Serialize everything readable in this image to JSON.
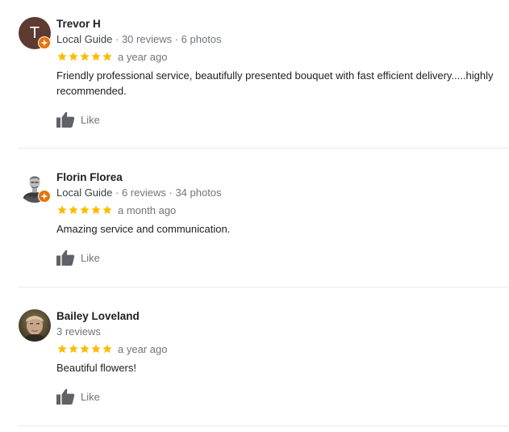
{
  "colors": {
    "star": "#fbbc04",
    "meta": "#70757a",
    "text": "#202124",
    "guide_badge": "#e8710a",
    "letter_avatar_bg": "#5d3b32"
  },
  "reviews": [
    {
      "avatar_letter": "T",
      "name": "Trevor H",
      "guide": "Local Guide",
      "sep1": " · ",
      "reviews_count": "30 reviews",
      "sep2": " · ",
      "photos_count": "6 photos",
      "rating": 5,
      "date": "a year ago",
      "text": "Friendly professional service,  beautifully presented bouquet with fast efficient delivery.....highly recommended.",
      "like_label": "Like",
      "is_local_guide": true
    },
    {
      "avatar_letter": "",
      "name": "Florin Florea",
      "guide": "Local Guide",
      "sep1": " · ",
      "reviews_count": "6 reviews",
      "sep2": " · ",
      "photos_count": "34 photos",
      "rating": 5,
      "date": "a month ago",
      "text": "Amazing service and communication.",
      "like_label": "Like",
      "is_local_guide": true
    },
    {
      "avatar_letter": "",
      "name": "Bailey Loveland",
      "reviews_count": "3 reviews",
      "rating": 5,
      "date": "a year ago",
      "text": "Beautiful flowers!",
      "like_label": "Like",
      "is_local_guide": false
    }
  ],
  "icons": {
    "star": "star-icon",
    "like": "thumbs-up-icon",
    "guide": "local-guide-badge-icon"
  }
}
